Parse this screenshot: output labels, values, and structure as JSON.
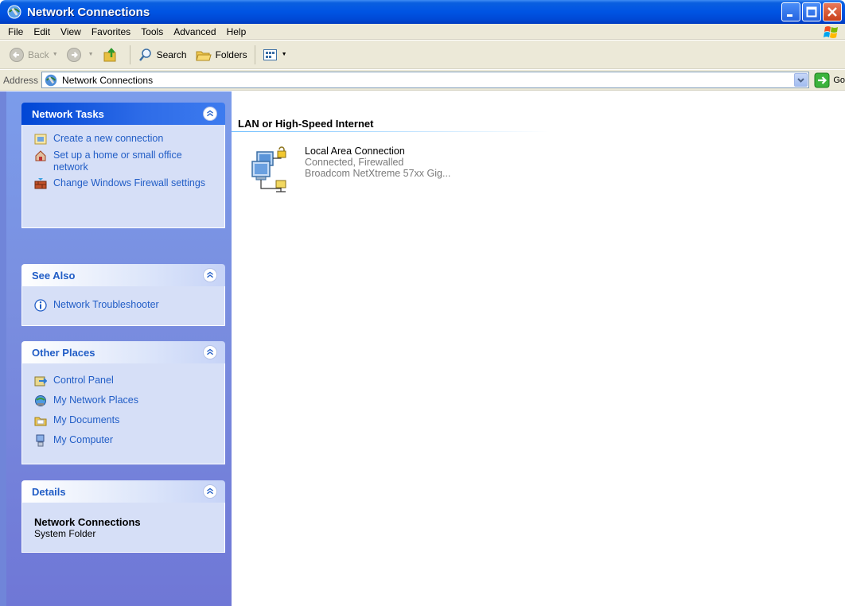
{
  "window": {
    "title": "Network Connections"
  },
  "menubar": [
    "File",
    "Edit",
    "View",
    "Favorites",
    "Tools",
    "Advanced",
    "Help"
  ],
  "toolbar": {
    "back": "Back",
    "search": "Search",
    "folders": "Folders"
  },
  "address": {
    "label": "Address",
    "value": "Network Connections",
    "go": "Go"
  },
  "panels": {
    "network_tasks": {
      "title": "Network Tasks",
      "items": [
        "Create a new connection",
        "Set up a home or small office network",
        "Change Windows Firewall settings"
      ]
    },
    "see_also": {
      "title": "See Also",
      "items": [
        "Network Troubleshooter"
      ]
    },
    "other_places": {
      "title": "Other Places",
      "items": [
        "Control Panel",
        "My Network Places",
        "My Documents",
        "My Computer"
      ]
    },
    "details": {
      "title": "Details",
      "name": "Network Connections",
      "type": "System Folder"
    }
  },
  "content": {
    "group_header": "LAN or High-Speed Internet",
    "connection": {
      "name": "Local Area Connection",
      "status": "Connected, Firewalled",
      "device": "Broadcom NetXtreme 57xx Gig..."
    }
  }
}
